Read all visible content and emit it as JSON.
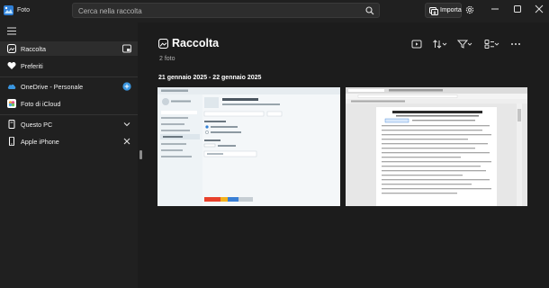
{
  "app": {
    "title": "Foto",
    "brand_color": "#4aa3f0"
  },
  "search": {
    "placeholder": "Cerca nella raccolta",
    "icon": "search-icon"
  },
  "titlebar": {
    "import_label": "Importa",
    "settings_icon": "gear-icon",
    "window_controls": [
      "minimize-icon",
      "maximize-icon",
      "close-icon"
    ]
  },
  "sidebar": {
    "items": [
      {
        "label": "Raccolta",
        "icon": "collection-icon",
        "active": true,
        "action_icon": "frame-icon"
      },
      {
        "label": "Preferiti",
        "icon": "heart-icon"
      },
      {
        "label": "OneDrive - Personale",
        "icon": "cloud-icon",
        "action_icon": "add-icon"
      },
      {
        "label": "Foto di iCloud",
        "icon": "icloud-icon"
      },
      {
        "label": "Questo PC",
        "icon": "pc-icon",
        "action_icon": "chevron-down-icon"
      },
      {
        "label": "Apple iPhone",
        "icon": "phone-icon",
        "action_icon": "close-icon"
      }
    ]
  },
  "main": {
    "title": "Raccolta",
    "count": "2 foto",
    "date_range": "21 gennaio 2025 - 22 gennaio 2025",
    "toolbar_icons": [
      "slideshow-icon",
      "sort-icon",
      "filter-icon",
      "view-icon",
      "more-icon"
    ],
    "photos": [
      {
        "name": "Screenshot impostazioni",
        "kind": "settings-window"
      },
      {
        "name": "Screenshot documento",
        "kind": "document-window"
      }
    ]
  }
}
